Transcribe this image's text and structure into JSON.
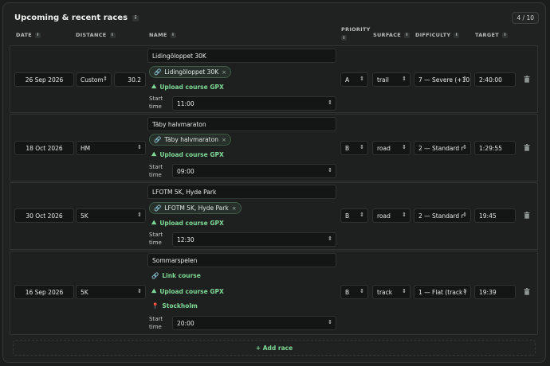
{
  "panel": {
    "title": "Upcoming & recent races",
    "count": "4 / 10"
  },
  "columns": {
    "date": "DATE",
    "distance": "DISTANCE",
    "name": "NAME",
    "priority_1": "PRIORITY",
    "surface": "SURFACE",
    "difficulty": "DIFFICULTY",
    "target": "TARGET"
  },
  "start_time_label_1": "Start",
  "start_time_label_2": "time",
  "rows": [
    {
      "date": "26 Sep 2026",
      "distance": "Custom",
      "distance_km": "30.2",
      "name": "Lidingöloppet 30K",
      "link_chip": "Lidingöloppet 30K",
      "upload": "Upload course GPX",
      "start_time": "11:00",
      "priority": "A",
      "surface": "trail",
      "difficulty": "7 — Severe (+10",
      "target": "2:40:00"
    },
    {
      "date": "18 Oct 2026",
      "distance": "HM",
      "name": "Täby halvmaraton",
      "link_chip": "Täby halvmaraton",
      "upload": "Upload course GPX",
      "start_time": "09:00",
      "priority": "B",
      "surface": "road",
      "difficulty": "2 — Standard r",
      "target": "1:29:55"
    },
    {
      "date": "30 Oct 2026",
      "distance": "5K",
      "name": "LFOTM 5K, Hyde Park",
      "link_chip": "LFOTM 5K, Hyde Park",
      "upload": "Upload course GPX",
      "start_time": "12:30",
      "priority": "B",
      "surface": "road",
      "difficulty": "2 — Standard r",
      "target": "19:45"
    },
    {
      "date": "16 Sep 2026",
      "distance": "5K",
      "name": "Sommarspelen",
      "link_course": "Link course",
      "upload": "Upload course GPX",
      "location": "Stockholm",
      "start_time": "20:00",
      "priority": "B",
      "surface": "track",
      "difficulty": "1 — Flat (track /",
      "target": "19:39"
    }
  ],
  "add_race": "+ Add race",
  "colors": {
    "accent": "#7fd896",
    "background": "#1b1d1c",
    "field": "#141615"
  },
  "icons": [
    "info-icon",
    "link-icon",
    "mountain-icon",
    "location-pin-icon",
    "chevron-updown-icon",
    "trash-icon"
  ]
}
